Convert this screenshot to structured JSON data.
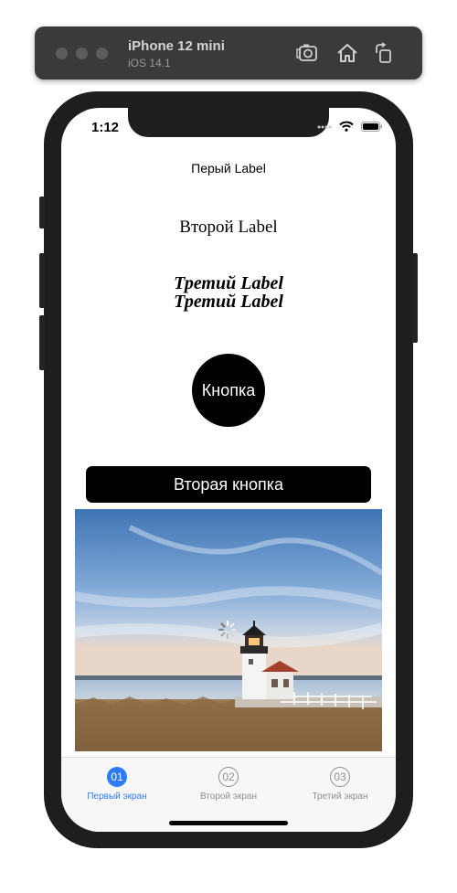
{
  "simulator": {
    "device_name": "iPhone 12 mini",
    "os_version": "iOS 14.1"
  },
  "status_bar": {
    "time": "1:12"
  },
  "content": {
    "label1": "Перый Label",
    "label2": "Второй Label",
    "label3_line1": "Третий Label",
    "label3_line2": "Третий Label",
    "button_circle": "Кнопка",
    "button_wide": "Вторая кнопка"
  },
  "tabbar": {
    "tabs": [
      {
        "number": "01",
        "label": "Первый экран",
        "selected": true
      },
      {
        "number": "02",
        "label": "Второй экран",
        "selected": false
      },
      {
        "number": "03",
        "label": "Третий экран",
        "selected": false
      }
    ]
  },
  "colors": {
    "accent": "#2f7bf5",
    "inactive_tab": "#8e8e93",
    "toolbar": "#3a3a3c",
    "bezel": "#1e1e1e"
  },
  "icons": [
    "screenshot-icon",
    "home-icon",
    "rotate-icon",
    "wifi-icon",
    "battery-icon",
    "signal-icon",
    "activity-spinner-icon"
  ]
}
